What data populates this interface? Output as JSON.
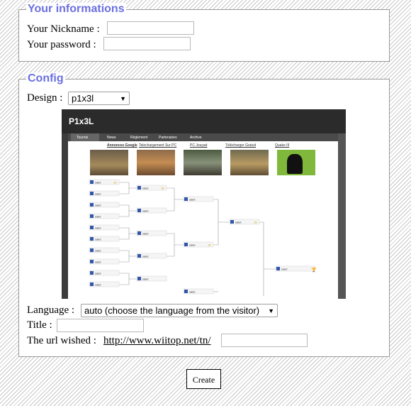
{
  "info": {
    "legend": "Your informations",
    "nickname_label": "Your Nickname :",
    "nickname_value": "",
    "password_label": "Your password :",
    "password_value": ""
  },
  "config": {
    "legend": "Config",
    "design_label": "Design :",
    "design_value": "p1x3l",
    "preview": {
      "logo": "P1x3L",
      "nav": [
        "Tournoi",
        "News",
        "Règlement",
        "Partenaires",
        "Archive"
      ],
      "thumb_labels": [
        "Annonces Google",
        "Telechargement Sur PC",
        "PC Jouyad",
        "Télécharger Gratuit",
        "Quake III"
      ],
      "bracket_name": "salut",
      "bracket_score": "15"
    },
    "language_label": "Language :",
    "language_value": "auto (choose the language from the visitor)",
    "title_label": "Title :",
    "title_value": "",
    "url_label": "The url wished :",
    "url_prefix": "http://www.wiitop.net/tn/",
    "url_value": "",
    "url_suffix": "/"
  },
  "create_label": "Create",
  "icons": {
    "dropdown": "chevron-down-icon"
  }
}
